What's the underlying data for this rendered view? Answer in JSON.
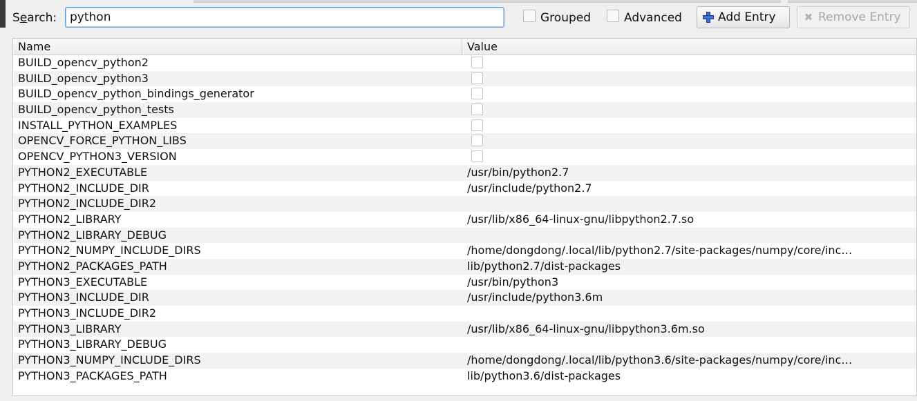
{
  "toolbar": {
    "search_label": "Search:",
    "search_value": "python",
    "grouped_label": "Grouped",
    "advanced_label": "Advanced",
    "add_entry_label": "Add Entry",
    "remove_entry_label": "Remove Entry",
    "add_icon": "plus-icon",
    "remove_icon": "x-icon"
  },
  "table": {
    "columns": [
      "Name",
      "Value"
    ],
    "rows": [
      {
        "name": "BUILD_opencv_python2",
        "value": "",
        "checkbox": true
      },
      {
        "name": "BUILD_opencv_python3",
        "value": "",
        "checkbox": true
      },
      {
        "name": "BUILD_opencv_python_bindings_generator",
        "value": "",
        "checkbox": true
      },
      {
        "name": "BUILD_opencv_python_tests",
        "value": "",
        "checkbox": true
      },
      {
        "name": "INSTALL_PYTHON_EXAMPLES",
        "value": "",
        "checkbox": true
      },
      {
        "name": "OPENCV_FORCE_PYTHON_LIBS",
        "value": "",
        "checkbox": true
      },
      {
        "name": "OPENCV_PYTHON3_VERSION",
        "value": "",
        "checkbox": true
      },
      {
        "name": "PYTHON2_EXECUTABLE",
        "value": "/usr/bin/python2.7",
        "checkbox": false
      },
      {
        "name": "PYTHON2_INCLUDE_DIR",
        "value": "/usr/include/python2.7",
        "checkbox": false
      },
      {
        "name": "PYTHON2_INCLUDE_DIR2",
        "value": "",
        "checkbox": false
      },
      {
        "name": "PYTHON2_LIBRARY",
        "value": "/usr/lib/x86_64-linux-gnu/libpython2.7.so",
        "checkbox": false
      },
      {
        "name": "PYTHON2_LIBRARY_DEBUG",
        "value": "",
        "checkbox": false
      },
      {
        "name": "PYTHON2_NUMPY_INCLUDE_DIRS",
        "value": "/home/dongdong/.local/lib/python2.7/site-packages/numpy/core/inc…",
        "checkbox": false
      },
      {
        "name": "PYTHON2_PACKAGES_PATH",
        "value": "lib/python2.7/dist-packages",
        "checkbox": false
      },
      {
        "name": "PYTHON3_EXECUTABLE",
        "value": "/usr/bin/python3",
        "checkbox": false
      },
      {
        "name": "PYTHON3_INCLUDE_DIR",
        "value": "/usr/include/python3.6m",
        "checkbox": false
      },
      {
        "name": "PYTHON3_INCLUDE_DIR2",
        "value": "",
        "checkbox": false
      },
      {
        "name": "PYTHON3_LIBRARY",
        "value": "/usr/lib/x86_64-linux-gnu/libpython3.6m.so",
        "checkbox": false
      },
      {
        "name": "PYTHON3_LIBRARY_DEBUG",
        "value": "",
        "checkbox": false
      },
      {
        "name": "PYTHON3_NUMPY_INCLUDE_DIRS",
        "value": "/home/dongdong/.local/lib/python3.6/site-packages/numpy/core/inc…",
        "checkbox": false
      },
      {
        "name": "PYTHON3_PACKAGES_PATH",
        "value": "lib/python3.6/dist-packages",
        "checkbox": false
      }
    ]
  }
}
